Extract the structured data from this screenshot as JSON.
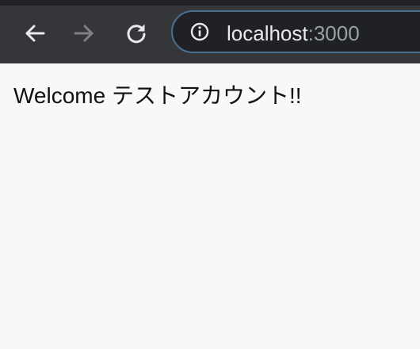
{
  "browser": {
    "address_bar": {
      "host": "localhost",
      "port": ":3000"
    },
    "icons": {
      "back": "back-arrow-icon",
      "forward": "forward-arrow-icon",
      "reload": "reload-icon",
      "info": "info-icon"
    },
    "forward_enabled": false
  },
  "page": {
    "welcome_text": "Welcome テストアカウント!!"
  },
  "colors": {
    "toolbar": "#35363a",
    "omnibox_border": "#4a6f95",
    "page_background": "#f8f8f8"
  }
}
